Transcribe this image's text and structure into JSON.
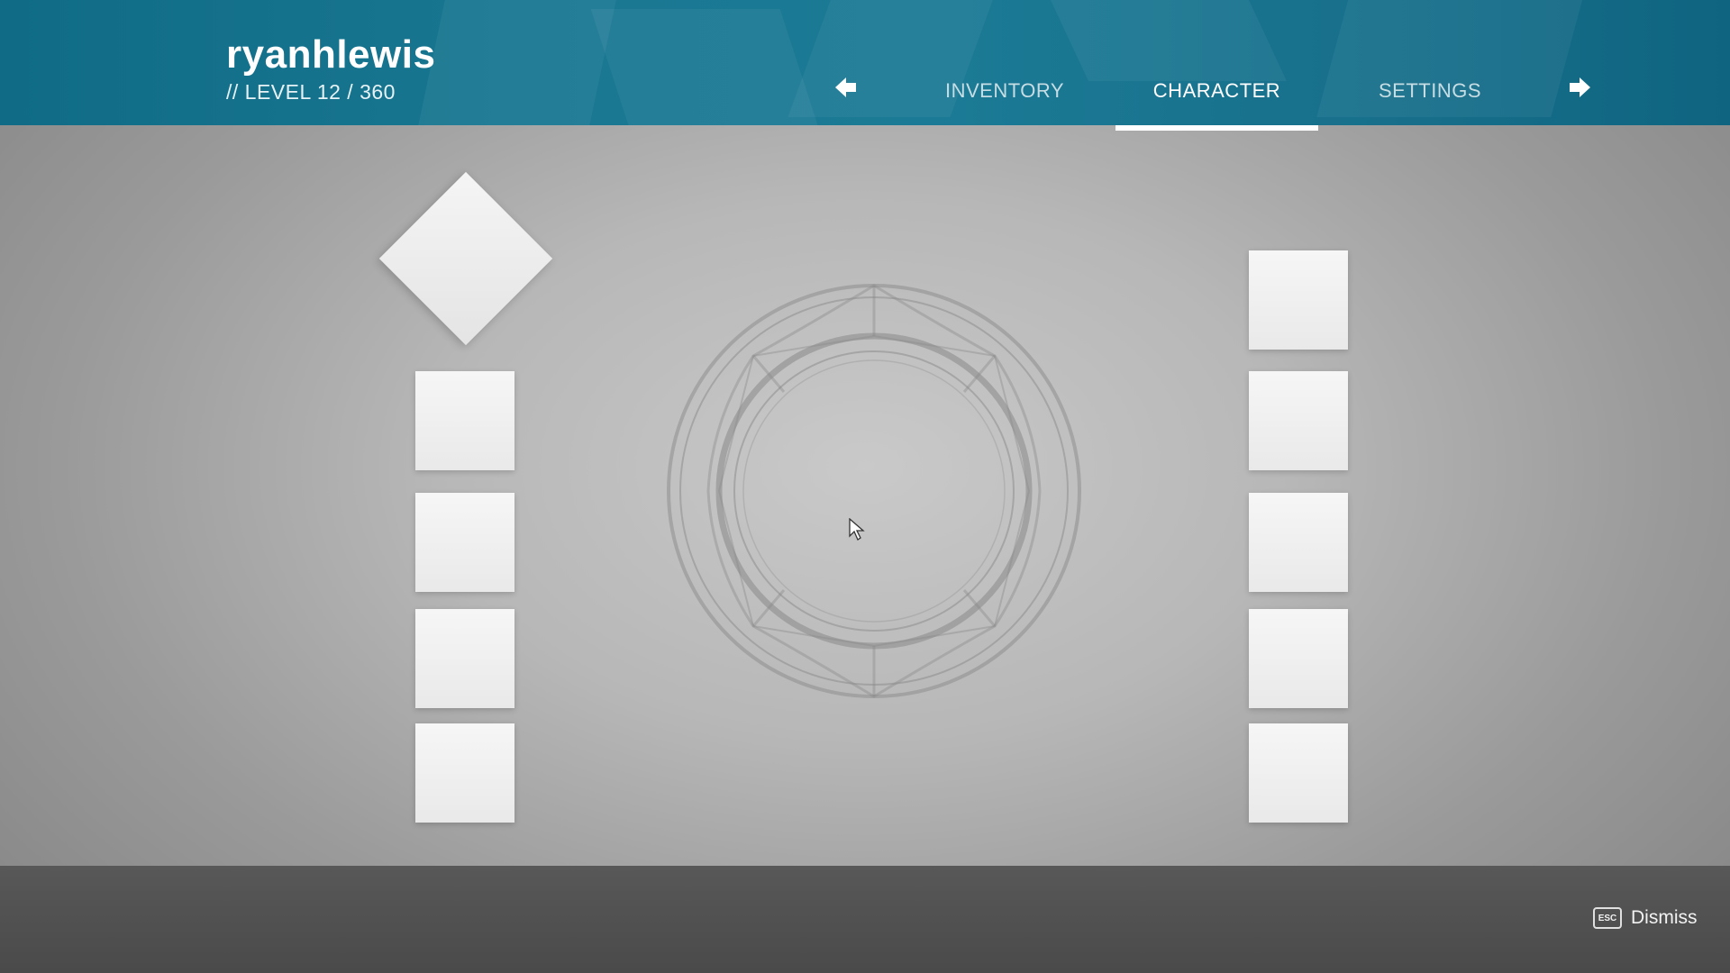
{
  "header": {
    "player_name": "ryanhlewis",
    "level_text": "// LEVEL 12 / 360",
    "background_color": "#1a7893"
  },
  "nav": {
    "prev_icon": "arrow-left-icon",
    "next_icon": "arrow-right-icon",
    "tabs": [
      {
        "label": "INVENTORY",
        "active": false
      },
      {
        "label": "CHARACTER",
        "active": true
      },
      {
        "label": "SETTINGS",
        "active": false
      }
    ]
  },
  "character": {
    "emblem_icon": "character-emblem-icon",
    "left_slots": [
      "slot",
      "slot",
      "slot",
      "slot"
    ],
    "right_slots": [
      "slot",
      "slot",
      "slot",
      "slot",
      "slot"
    ]
  },
  "footer": {
    "dismiss_key": "ESC",
    "dismiss_label": "Dismiss"
  }
}
